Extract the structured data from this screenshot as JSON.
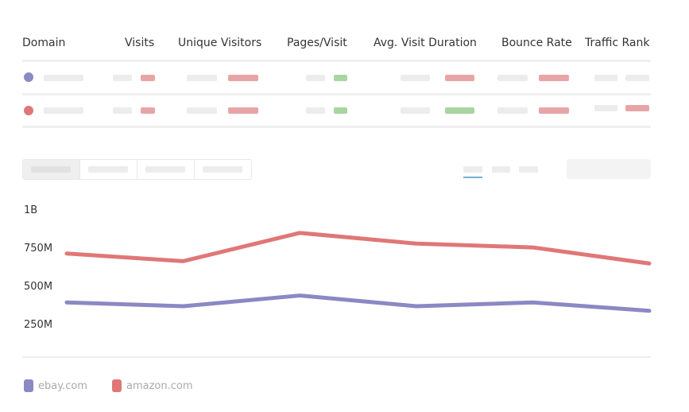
{
  "table": {
    "headers": [
      "Domain",
      "Visits",
      "Unique Visitors",
      "Pages/Visit",
      "Avg. Visit Duration",
      "Bounce Rate",
      "Traffic Rank"
    ],
    "rows": [
      {
        "color": "#8b88c4"
      },
      {
        "color": "#e07777"
      }
    ]
  },
  "chart_data": {
    "type": "line",
    "y_ticks": [
      "1B",
      "750M",
      "500M",
      "250M"
    ],
    "ylim": [
      0,
      1000000000
    ],
    "grid": false,
    "legend": "bottom-left",
    "series": [
      {
        "name": "ebay.com",
        "color": "#8b88c4",
        "values": [
          400000000,
          375000000,
          445000000,
          375000000,
          400000000,
          345000000
        ]
      },
      {
        "name": "amazon.com",
        "color": "#e07777",
        "values": [
          720000000,
          670000000,
          855000000,
          785000000,
          760000000,
          655000000
        ]
      }
    ]
  }
}
